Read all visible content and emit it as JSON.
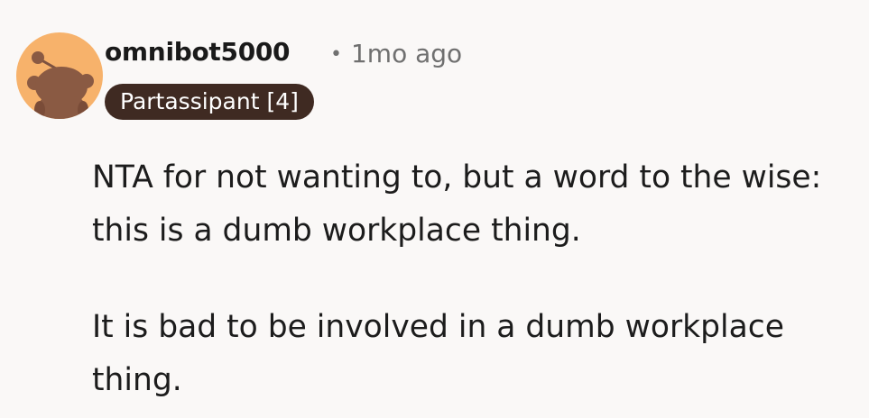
{
  "comment": {
    "author": "omnibot5000",
    "separator": "•",
    "timestamp": "1mo ago",
    "flair": "Partassipant [4]",
    "avatar_icon": "snoo-avatar-icon",
    "paragraphs": [
      "NTA for not wanting to, but a word to the wise: this is a dumb workplace thing.",
      "It is bad to be involved in a dumb workplace thing."
    ]
  },
  "colors": {
    "background": "#faf8f7",
    "avatar_bg": "#f7b26b",
    "snoo_body": "#8a5a43",
    "flair_bg": "#3f2a22",
    "flair_text": "#ffffff",
    "meta_text": "#707070",
    "body_text": "#1c1c1c"
  }
}
